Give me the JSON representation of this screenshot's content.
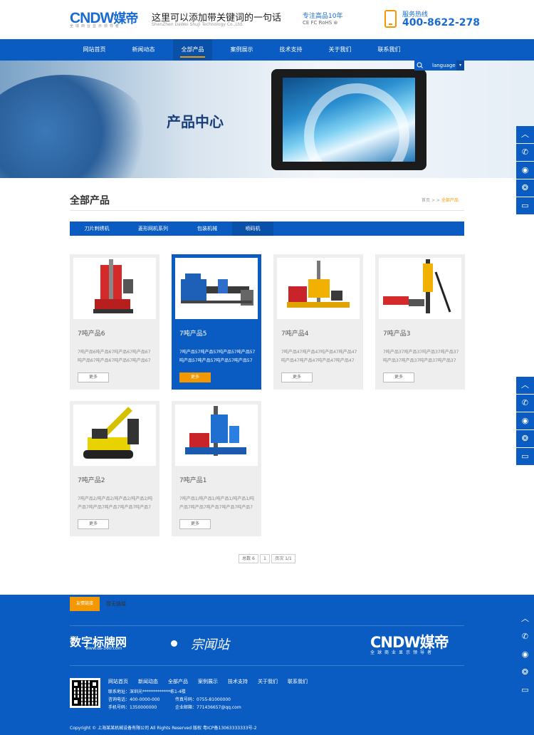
{
  "header": {
    "brand_en": "CNDW",
    "brand_cn": "媒帝",
    "brand_sub": "全球商业显示领导者",
    "slogan": "这里可以添加带关键词的一句话",
    "slogan_en": "ShenZhen DaWei ShuJi Technology Co.,Ltd.",
    "focus": "专注高品10年",
    "certs": "CE FC RoHS ⊛",
    "hotline_label": "服务热线",
    "hotline": "400-8622-278"
  },
  "nav": {
    "items": [
      "网站首页",
      "新闻动态",
      "全部产品",
      "案例展示",
      "技术支持",
      "关于我们",
      "联系我们"
    ],
    "active_index": 2
  },
  "language": {
    "label": "language",
    "arrow": "▾",
    "search_icon": "search-icon"
  },
  "banner": {
    "title": "产品中心"
  },
  "page": {
    "title": "全部产品",
    "breadcrumb": {
      "home": "首页",
      "sep1": ">",
      "sep2": ">",
      "current": "全部产品"
    }
  },
  "categories": {
    "items": [
      "刀片刺绣机",
      "菱形网机系列",
      "包装机械",
      "喷码机"
    ],
    "active_index": 3
  },
  "products": [
    {
      "name": "7吨产品6",
      "desc": "7吨产品6吨产品67吨产品67吨产品67吨产品67吨产品67吨产品67吨产品67吨产",
      "more": "更多",
      "highlight": false
    },
    {
      "name": "7吨产品5",
      "desc": "7吨产品57吨产品57吨产品57吨产品57吨产品57吨产品57吨产品57吨产品57吨产",
      "more": "更多",
      "highlight": true
    },
    {
      "name": "7吨产品4",
      "desc": "7吨产品47吨产品47吨产品47吨产品47吨产品47吨产品47吨产品47吨产品47吨产",
      "more": "更多",
      "highlight": false
    },
    {
      "name": "7吨产品3",
      "desc": "7吨产品37吨产品37吨产品37吨产品37吨产品37吨产品37吨产品37吨产品37吨产",
      "more": "更多",
      "highlight": false
    },
    {
      "name": "7吨产品2",
      "desc": "7吨产品2/吨产品2/吨产品2/吨产品2/吨产品7吨产品7吨产品7吨产品7吨产品7吨产",
      "more": "更多",
      "highlight": false
    },
    {
      "name": "7吨产品1",
      "desc": "7吨产品1/吨产品1/吨产品1/吨产品1/吨产品7吨产品7吨产品7吨产品7吨产品7吨产",
      "more": "更多",
      "highlight": false
    }
  ],
  "pagination": {
    "total": "总数 6",
    "current": "1",
    "pages": "页次 1/1"
  },
  "footer": {
    "links_label": "友情链接",
    "links_value": "暂无链接",
    "ds_logo": "数字标牌网",
    "ds_sub": "www.ds-360.com",
    "ds_script": "宗闻站",
    "brand_en": "CNDW",
    "brand_cn": "媒帝",
    "brand_sub": "全球商业显示领导者",
    "nav": [
      "网站首页",
      "新闻动态",
      "全部产品",
      "案例展示",
      "技术支持",
      "关于我们",
      "联系我们"
    ],
    "address": "联系地址：深圳光*************栋1-4楼",
    "tel": "咨询电话：400-0000-000",
    "fax": "传真号码：0755-81000000",
    "mobile": "手机号码：1350000000",
    "email": "企业邮箱：771436657@qq.com",
    "copyright": "Copyright © 上海某某机械设备有限公司 All Rights Reserved 版权 粤ICP备13063333333号-2"
  },
  "side_icons": [
    "chevron-up-icon",
    "phone-icon",
    "qq-icon",
    "wechat-icon",
    "message-icon"
  ],
  "colors": {
    "primary": "#0a5cc2",
    "accent": "#f39800"
  }
}
